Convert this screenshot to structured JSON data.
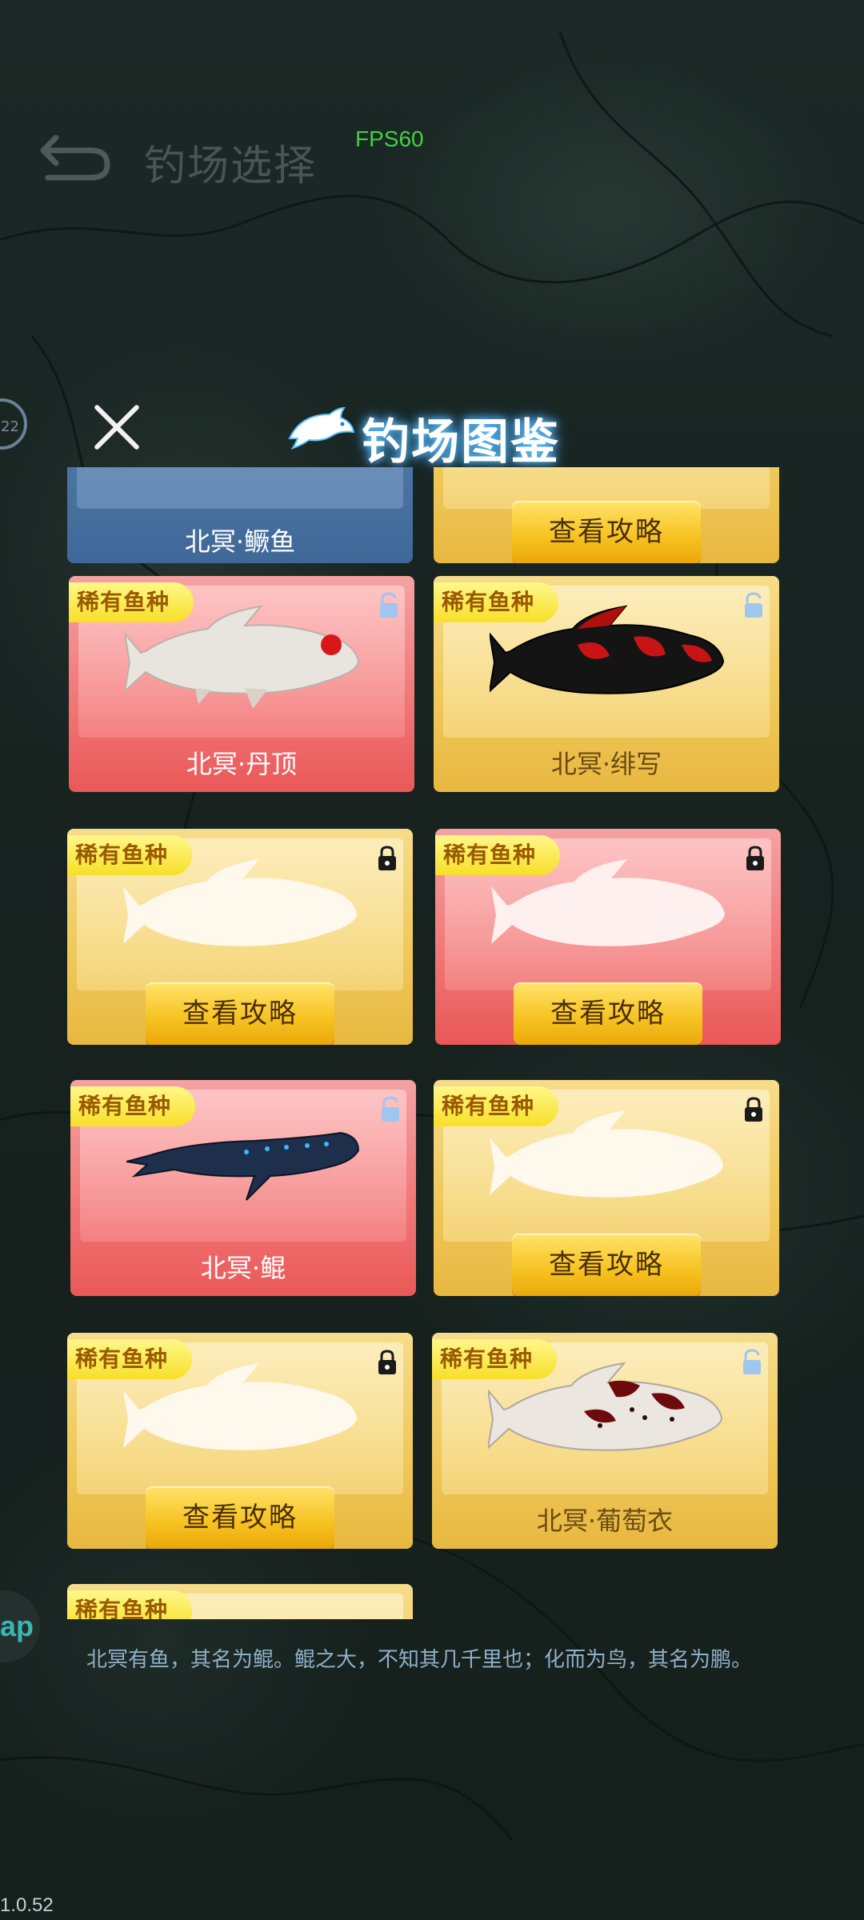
{
  "header": {
    "title": "钓场选择",
    "fps": "FPS60"
  },
  "side": {
    "badge_left": "22",
    "badge_bottom": "ap"
  },
  "version": "1.0.52",
  "overlay": {
    "title": "钓场图鉴",
    "quote": "北冥有鱼，其名为鲲。鲲之大，不知其几千里也；化而为鸟，其名为鹏。",
    "rare_tag": "稀有鱼种",
    "guide_label": "查看攻略",
    "cards": [
      {
        "name": "北冥·鳜鱼",
        "theme": "blue",
        "state": "unlocked"
      },
      {
        "name": "",
        "theme": "gold",
        "state": "locked"
      },
      {
        "name": "北冥·丹顶",
        "theme": "red",
        "state": "unlocked",
        "fish": "tancho-koi-icon"
      },
      {
        "name": "北冥·绯写",
        "theme": "gold",
        "state": "unlocked",
        "fish": "hi-utsuri-koi-icon"
      },
      {
        "name": "",
        "theme": "gold",
        "state": "locked"
      },
      {
        "name": "",
        "theme": "red",
        "state": "locked"
      },
      {
        "name": "北冥·鲲",
        "theme": "red",
        "state": "unlocked",
        "fish": "kun-whale-icon"
      },
      {
        "name": "",
        "theme": "gold",
        "state": "locked"
      },
      {
        "name": "",
        "theme": "gold",
        "state": "locked"
      },
      {
        "name": "北冥·葡萄衣",
        "theme": "gold",
        "state": "unlocked",
        "fish": "budo-goromo-koi-icon"
      }
    ],
    "colors": {
      "gold_card": "#f0c95c",
      "red_card": "#f17575",
      "blue_card": "#3f6898",
      "rare_tag": "#f7df28",
      "fps_green": "#3fd23f"
    }
  }
}
